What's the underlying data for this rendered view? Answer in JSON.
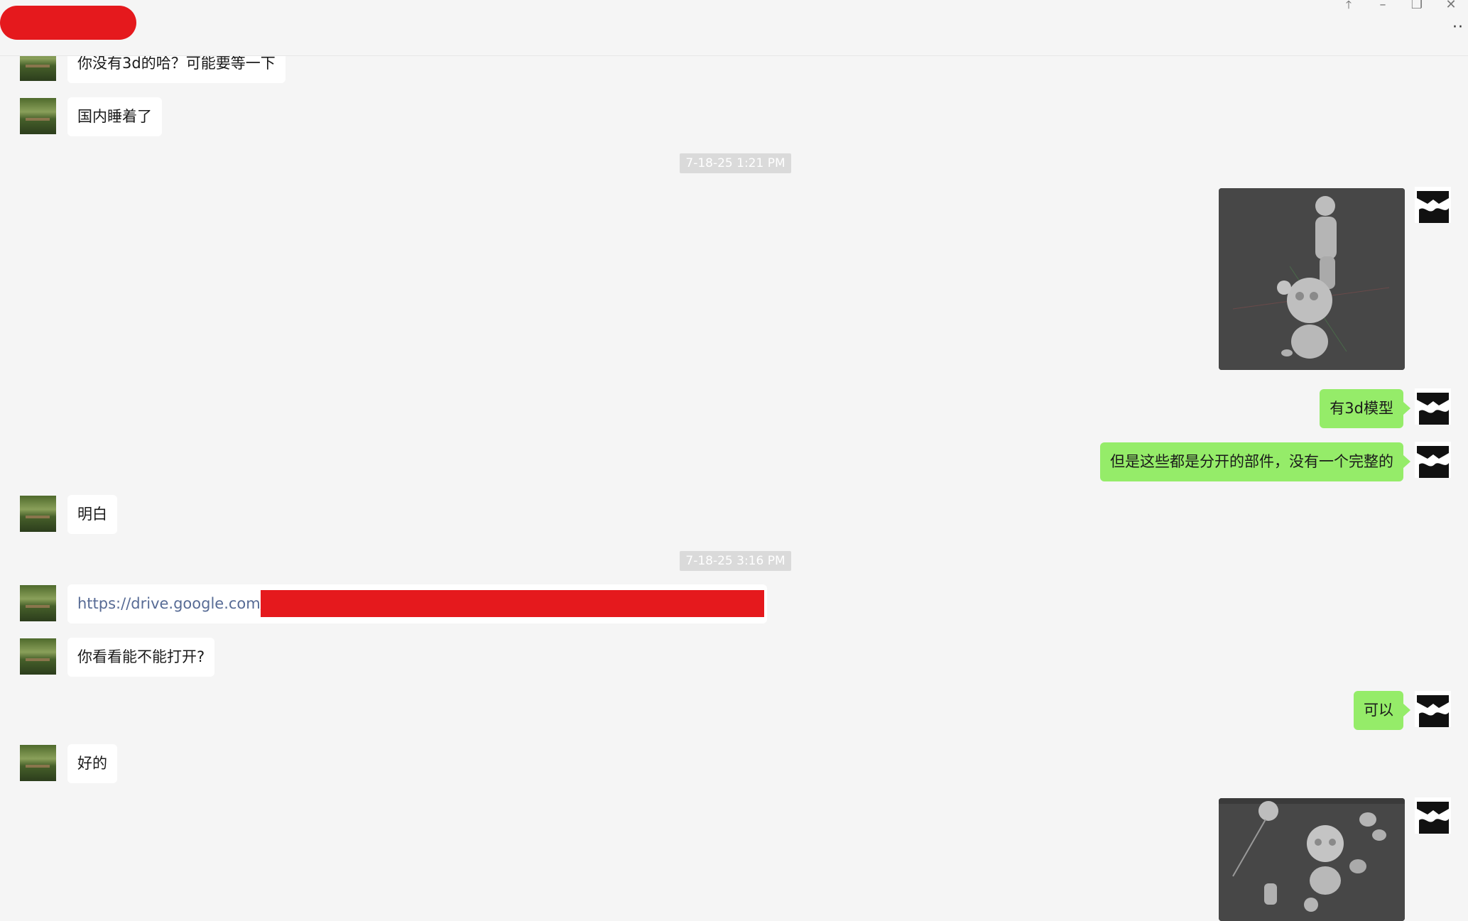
{
  "window": {
    "controls": [
      "⤒",
      "–",
      "❐",
      "✕"
    ],
    "more_icon": "··"
  },
  "messages": {
    "m1": "你没有3d的哈？可能要等一下",
    "m2": "国内睡着了",
    "ts1": "7-18-25 1:21 PM",
    "m4": "有3d模型",
    "m5": "但是这些都是分开的部件，没有一个完整的",
    "m6": "明白",
    "ts2": "7-18-25 3:16 PM",
    "link": "https://drive.google.com/",
    "m8": "你看看能不能打开?",
    "m9": "可以",
    "m10": "好的"
  },
  "colors": {
    "self_bubble": "#95ec69",
    "other_bubble": "#ffffff",
    "link": "#576b95",
    "redaction": "#e5191d",
    "background": "#f5f5f5"
  }
}
